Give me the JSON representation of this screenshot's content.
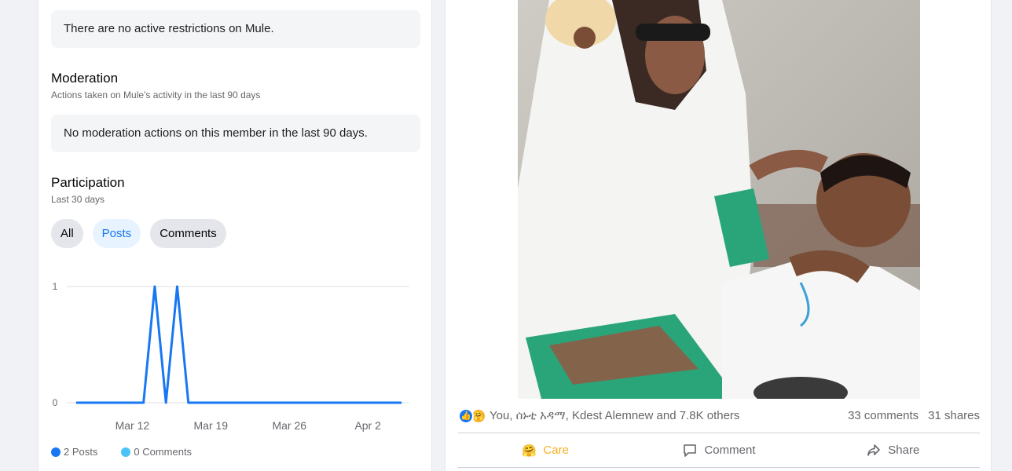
{
  "restrictions": {
    "text": "There are no active restrictions on Mule."
  },
  "moderation": {
    "title": "Moderation",
    "subtitle": "Actions taken on Mule's activity in the last 90 days",
    "text": "No moderation actions on this member in the last 90 days."
  },
  "participation": {
    "title": "Participation",
    "subtitle": "Last 30 days",
    "filters": [
      "All",
      "Posts",
      "Comments"
    ],
    "active_filter": "Posts",
    "legend": [
      {
        "label": "2 Posts",
        "color": "#1877f2"
      },
      {
        "label": "0 Comments",
        "color": "#4cc3f5"
      }
    ]
  },
  "chart_data": {
    "type": "line",
    "x_tick_labels": [
      "Mar 12",
      "Mar 19",
      "Mar 26",
      "Apr 2"
    ],
    "y_tick_labels": [
      "1",
      "0"
    ],
    "ylim": [
      0,
      1
    ],
    "series": [
      {
        "name": "Posts",
        "color": "#1877f2",
        "x": [
          "Mar 7",
          "Mar 8",
          "Mar 9",
          "Mar 10",
          "Mar 11",
          "Mar 12",
          "Mar 13",
          "Mar 14",
          "Mar 15",
          "Mar 16",
          "Mar 17",
          "Mar 18",
          "Mar 19",
          "Mar 20",
          "Mar 21",
          "Mar 22",
          "Mar 23",
          "Mar 24",
          "Mar 25",
          "Mar 26",
          "Mar 27",
          "Mar 28",
          "Mar 29",
          "Mar 30",
          "Mar 31",
          "Apr 1",
          "Apr 2",
          "Apr 3",
          "Apr 4",
          "Apr 5"
        ],
        "values": [
          0,
          0,
          0,
          0,
          0,
          0,
          0,
          1,
          0,
          1,
          0,
          0,
          0,
          0,
          0,
          0,
          0,
          0,
          0,
          0,
          0,
          0,
          0,
          0,
          0,
          0,
          0,
          0,
          0,
          0
        ]
      }
    ],
    "grid": true
  },
  "post": {
    "reaction_summary": "You, ሰኑቲ አዳማ, Kdest Alemnew and 7.8K others",
    "comments": "33 comments",
    "shares": "31 shares",
    "actions": [
      {
        "label": "Care",
        "icon": "care-emoji-icon"
      },
      {
        "label": "Comment",
        "icon": "comment-icon"
      },
      {
        "label": "Share",
        "icon": "share-arrow-icon"
      }
    ]
  }
}
